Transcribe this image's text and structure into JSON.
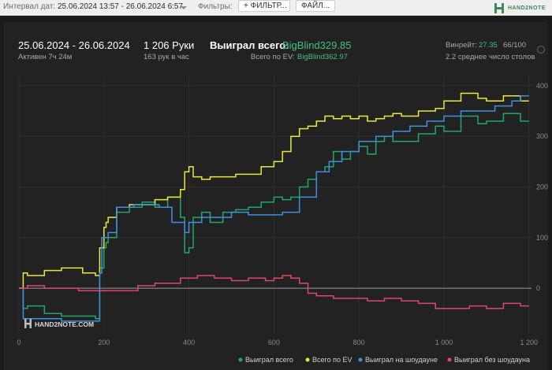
{
  "toolbar": {
    "date_label": "Интервал дат:",
    "date_value": "25.06.2024 13:57 - 26.06.2024 6:57",
    "filters_label": "Фильтры:",
    "filter_button": "+ ФИЛЬТР...",
    "file_button": "ФАЙЛ..."
  },
  "brand": {
    "name": "HAND2NOTE",
    "watermark": "HAND2NOTE.COM"
  },
  "summary": {
    "date_range": "25.06.2024 - 26.06.2024",
    "active": "Активен 7ч 24м",
    "hands": "1 206 Руки",
    "hands_per_hour": "163 рук в час",
    "won_label": "Выиграл всего:",
    "won_value": "BigBlind329.85",
    "ev_label": "Всего по EV:",
    "ev_value": "BigBlind362.97",
    "winrate_label": "Винрейт:",
    "winrate_value": "27.35",
    "winrate_sample": "66/100",
    "tables": "2.2 среднее число столов"
  },
  "colors": {
    "green": "#1fa86a",
    "yellow": "#e8e83a",
    "blue": "#3f8fe0",
    "pink": "#e0456f",
    "accent": "#43c07a"
  },
  "chart_data": {
    "type": "line",
    "xlim": [
      0,
      1206
    ],
    "ylim": [
      -90,
      420
    ],
    "xticks": [
      0,
      200,
      400,
      600,
      800,
      1000,
      1200
    ],
    "xtick_labels": [
      "0",
      "200",
      "400",
      "600",
      "800",
      "1 000",
      "1 200"
    ],
    "yticks": [
      0,
      100,
      200,
      300,
      400
    ],
    "ytick_labels": [
      "0",
      "100",
      "200",
      "300",
      "400"
    ],
    "legend_position": "bottom-right",
    "grid": true,
    "series": [
      {
        "name": "Выиграл всего",
        "color": "#1fa86a",
        "x": [
          0,
          10,
          20,
          60,
          100,
          150,
          180,
          190,
          200,
          205,
          210,
          230,
          260,
          290,
          320,
          350,
          380,
          390,
          400,
          410,
          430,
          450,
          480,
          510,
          540,
          570,
          600,
          620,
          640,
          660,
          680,
          700,
          720,
          740,
          760,
          780,
          800,
          820,
          840,
          860,
          880,
          900,
          940,
          980,
          1000,
          1040,
          1080,
          1100,
          1140,
          1180,
          1200
        ],
        "y": [
          0,
          -40,
          -35,
          -50,
          -55,
          -55,
          -60,
          40,
          80,
          90,
          100,
          150,
          160,
          170,
          160,
          180,
          140,
          70,
          80,
          140,
          150,
          130,
          150,
          155,
          160,
          170,
          180,
          175,
          180,
          200,
          215,
          230,
          240,
          270,
          255,
          270,
          280,
          265,
          290,
          300,
          290,
          290,
          305,
          320,
          310,
          340,
          325,
          330,
          345,
          330,
          330
        ]
      },
      {
        "name": "Всего по EV",
        "color": "#e8e83a",
        "x": [
          0,
          10,
          20,
          60,
          100,
          150,
          180,
          190,
          200,
          205,
          210,
          230,
          260,
          290,
          320,
          350,
          380,
          390,
          400,
          410,
          430,
          450,
          480,
          510,
          540,
          570,
          600,
          620,
          640,
          660,
          680,
          700,
          720,
          740,
          760,
          780,
          800,
          820,
          840,
          860,
          880,
          900,
          940,
          980,
          1000,
          1040,
          1080,
          1100,
          1140,
          1180,
          1200
        ],
        "y": [
          0,
          30,
          25,
          35,
          40,
          30,
          25,
          80,
          120,
          130,
          140,
          160,
          165,
          165,
          175,
          180,
          195,
          230,
          240,
          220,
          215,
          220,
          220,
          225,
          225,
          240,
          250,
          270,
          300,
          315,
          320,
          330,
          340,
          335,
          340,
          335,
          340,
          330,
          335,
          340,
          345,
          340,
          350,
          355,
          370,
          385,
          375,
          370,
          380,
          370,
          370
        ]
      },
      {
        "name": "Выиграл на шоудауне",
        "color": "#3f8fe0",
        "x": [
          0,
          10,
          60,
          100,
          150,
          180,
          190,
          195,
          200,
          210,
          230,
          270,
          300,
          330,
          360,
          390,
          400,
          430,
          460,
          500,
          540,
          580,
          620,
          660,
          700,
          730,
          760,
          800,
          840,
          880,
          920,
          960,
          1000,
          1040,
          1080,
          1120,
          1160,
          1180,
          1200
        ],
        "y": [
          0,
          -60,
          -60,
          -65,
          -65,
          -65,
          30,
          100,
          100,
          110,
          160,
          165,
          165,
          160,
          130,
          110,
          130,
          140,
          140,
          150,
          145,
          145,
          150,
          180,
          230,
          250,
          270,
          290,
          300,
          310,
          320,
          330,
          340,
          350,
          350,
          360,
          370,
          380,
          380
        ]
      },
      {
        "name": "Выиграл без шоудауна",
        "color": "#e0456f",
        "x": [
          0,
          20,
          60,
          100,
          140,
          180,
          200,
          240,
          280,
          320,
          360,
          380,
          400,
          420,
          460,
          500,
          540,
          580,
          600,
          620,
          640,
          660,
          680,
          700,
          720,
          740,
          780,
          820,
          860,
          900,
          940,
          980,
          1020,
          1060,
          1100,
          1140,
          1180,
          1200
        ],
        "y": [
          0,
          5,
          0,
          0,
          -5,
          -5,
          -5,
          -5,
          5,
          10,
          10,
          20,
          20,
          25,
          20,
          15,
          20,
          15,
          20,
          25,
          20,
          10,
          -10,
          -15,
          -15,
          -20,
          -20,
          -25,
          -20,
          -25,
          -30,
          -40,
          -40,
          -35,
          -40,
          -30,
          -35,
          -35
        ]
      }
    ]
  }
}
